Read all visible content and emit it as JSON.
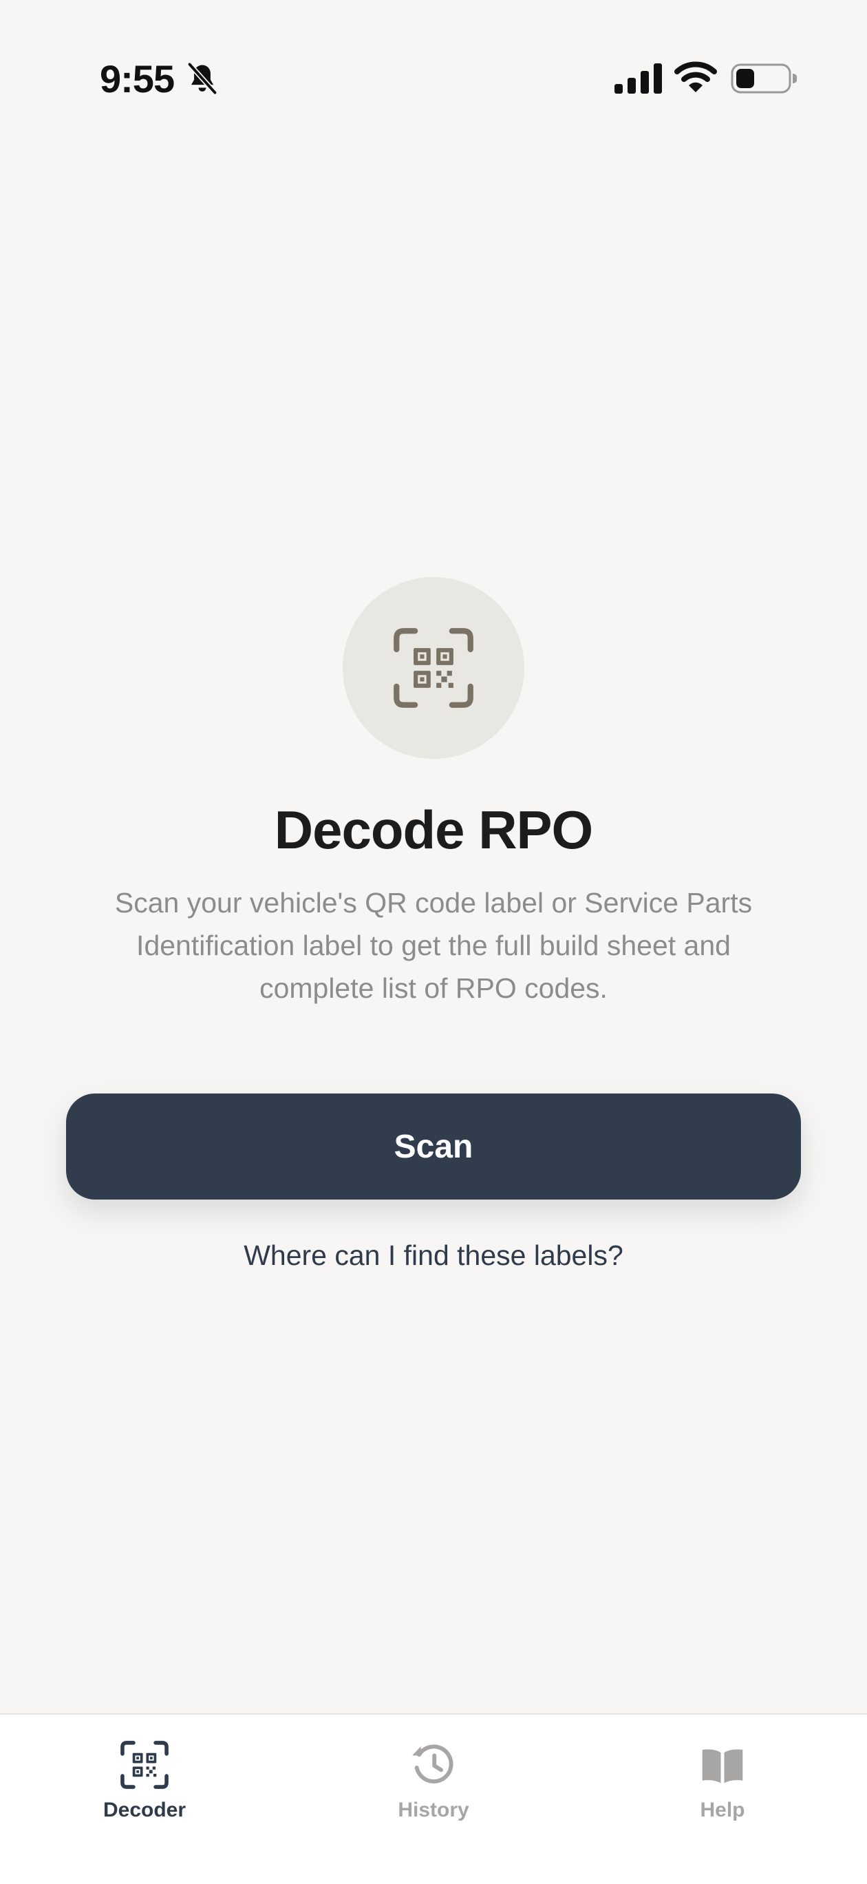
{
  "status_bar": {
    "time": "9:55",
    "icons": [
      "bell-slash-icon",
      "cellular-signal-icon",
      "wifi-icon",
      "battery-icon"
    ]
  },
  "hero": {
    "icon": "qr-scan-icon",
    "title": "Decode RPO",
    "description": "Scan your vehicle's QR code label or Service Parts Identification label to get the full build sheet and complete list of RPO codes."
  },
  "actions": {
    "scan_label": "Scan",
    "help_link": "Where can I find these labels?"
  },
  "tab_bar": {
    "tabs": [
      {
        "label": "Decoder",
        "icon": "qr-scan-icon",
        "active": true
      },
      {
        "label": "History",
        "icon": "history-clock-icon",
        "active": false
      },
      {
        "label": "Help",
        "icon": "book-icon",
        "active": false
      }
    ]
  },
  "colors": {
    "background": "#f7f6f4",
    "primary": "#313c4d",
    "icon_brown": "#7a7264",
    "circle": "#e9e7e2",
    "muted_text": "#8e8c89",
    "inactive_tab": "#a8a6a4"
  }
}
